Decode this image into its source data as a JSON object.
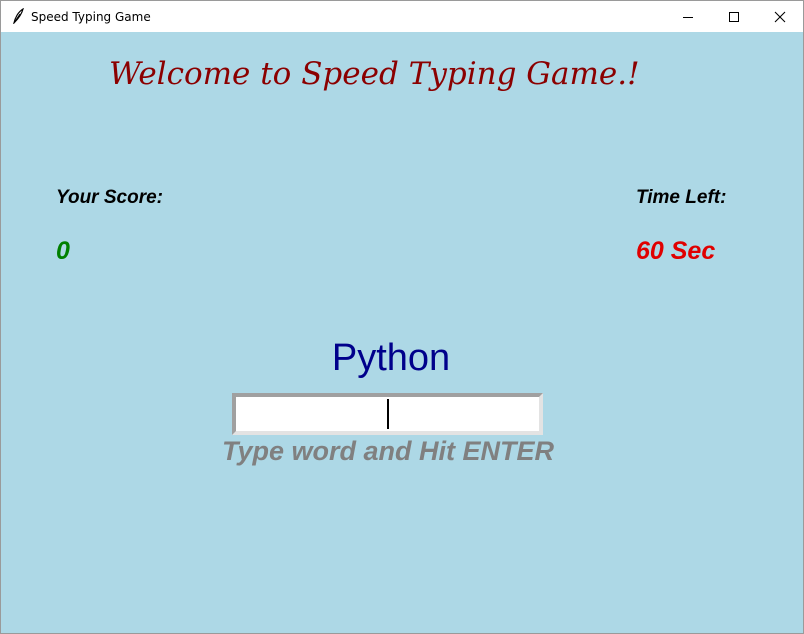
{
  "window": {
    "title": "Speed Typing Game",
    "icons": {
      "app": "feather-icon",
      "minimize": "minimize-icon",
      "maximize": "maximize-icon",
      "close": "close-icon"
    }
  },
  "game": {
    "welcome": "Welcome to Speed Typing Game.!",
    "score_label": "Your Score:",
    "score_value": "0",
    "time_label": "Time Left:",
    "time_value": "60 Sec",
    "current_word": "Python",
    "input_value": "",
    "instruction": "Type word and Hit ENTER"
  },
  "colors": {
    "background": "#add8e6",
    "welcome": "#8b0000",
    "score": "#008000",
    "time": "#e00000",
    "word": "#00008b",
    "instruction": "#808080"
  }
}
